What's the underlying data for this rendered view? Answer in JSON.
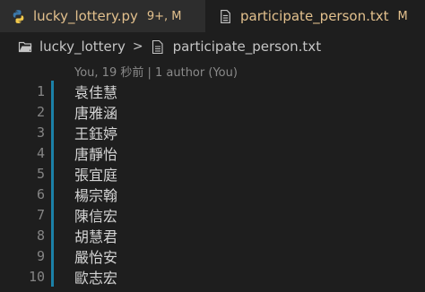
{
  "tabs": [
    {
      "label": "lucky_lottery.py",
      "status": "9+, M",
      "icon": "python-icon",
      "active": false
    },
    {
      "label": "participate_person.txt",
      "status": "M",
      "icon": "text-file-icon",
      "active": true
    }
  ],
  "breadcrumb": {
    "folder": "lucky_lottery",
    "separator": ">",
    "file": "participate_person.txt"
  },
  "blame": "You, 19 秒前 | 1 author (You)",
  "lines": [
    {
      "number": "1",
      "text": "袁佳慧"
    },
    {
      "number": "2",
      "text": "唐雅涵"
    },
    {
      "number": "3",
      "text": "王鈺婷"
    },
    {
      "number": "4",
      "text": "唐靜怡"
    },
    {
      "number": "5",
      "text": "張宜庭"
    },
    {
      "number": "6",
      "text": "楊宗翰"
    },
    {
      "number": "7",
      "text": "陳信宏"
    },
    {
      "number": "8",
      "text": "胡慧君"
    },
    {
      "number": "9",
      "text": "嚴怡安"
    },
    {
      "number": "10",
      "text": "歐志宏"
    }
  ],
  "colors": {
    "modified": "#e2c08d",
    "gutter_modified": "#1b81a8",
    "background": "#1e1e1e"
  }
}
